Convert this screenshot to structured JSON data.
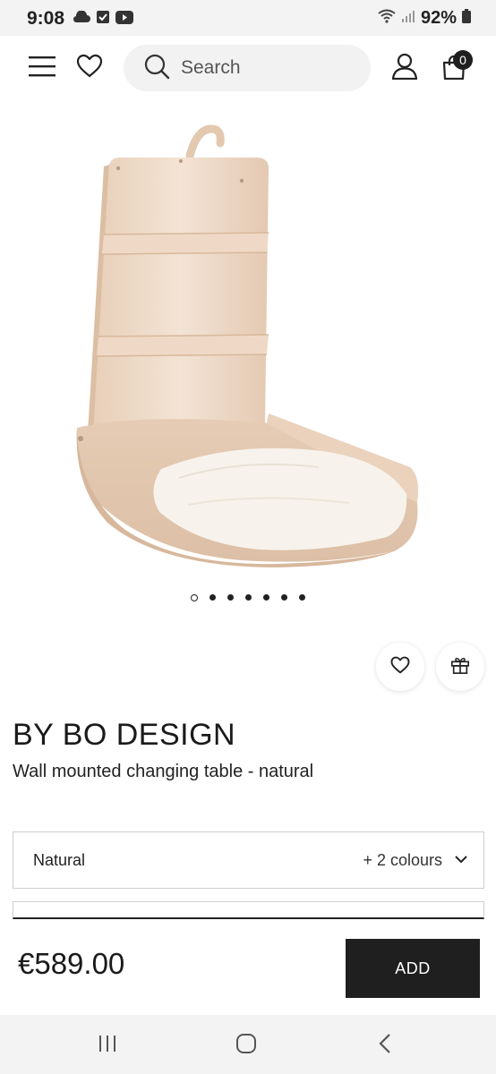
{
  "status_bar": {
    "time": "9:08",
    "battery": "92%",
    "left_icons": [
      "cloud-icon",
      "check-box-icon",
      "youtube-icon"
    ],
    "right_icons": [
      "wifi-icon",
      "signal-icon",
      "battery-icon"
    ]
  },
  "header": {
    "menu_icon": "menu-icon",
    "wishlist_icon": "heart-icon",
    "search_placeholder": "Search",
    "account_icon": "user-icon",
    "cart_icon": "shopping-bag-icon",
    "cart_count": "0"
  },
  "product": {
    "image_alt": "wall mounted changing table",
    "carousel": {
      "total": 7,
      "active_index": 0
    },
    "favorite_icon": "heart-icon",
    "gift_icon": "gift-icon",
    "brand": "BY BO DESIGN",
    "name": "Wall mounted changing table - natural",
    "variant_value": "Natural",
    "variant_more": "+ 2 colours",
    "price": "€589.00",
    "add_label": "ADD"
  },
  "android_nav": {
    "recent_icon": "recent-apps-icon",
    "home_icon": "home-icon",
    "back_icon": "back-icon"
  },
  "colors": {
    "primary": "#1f1f1f",
    "search_bg": "#f2f2f2",
    "wood": "#ecd6c3",
    "cushion": "#f6f2ea"
  }
}
